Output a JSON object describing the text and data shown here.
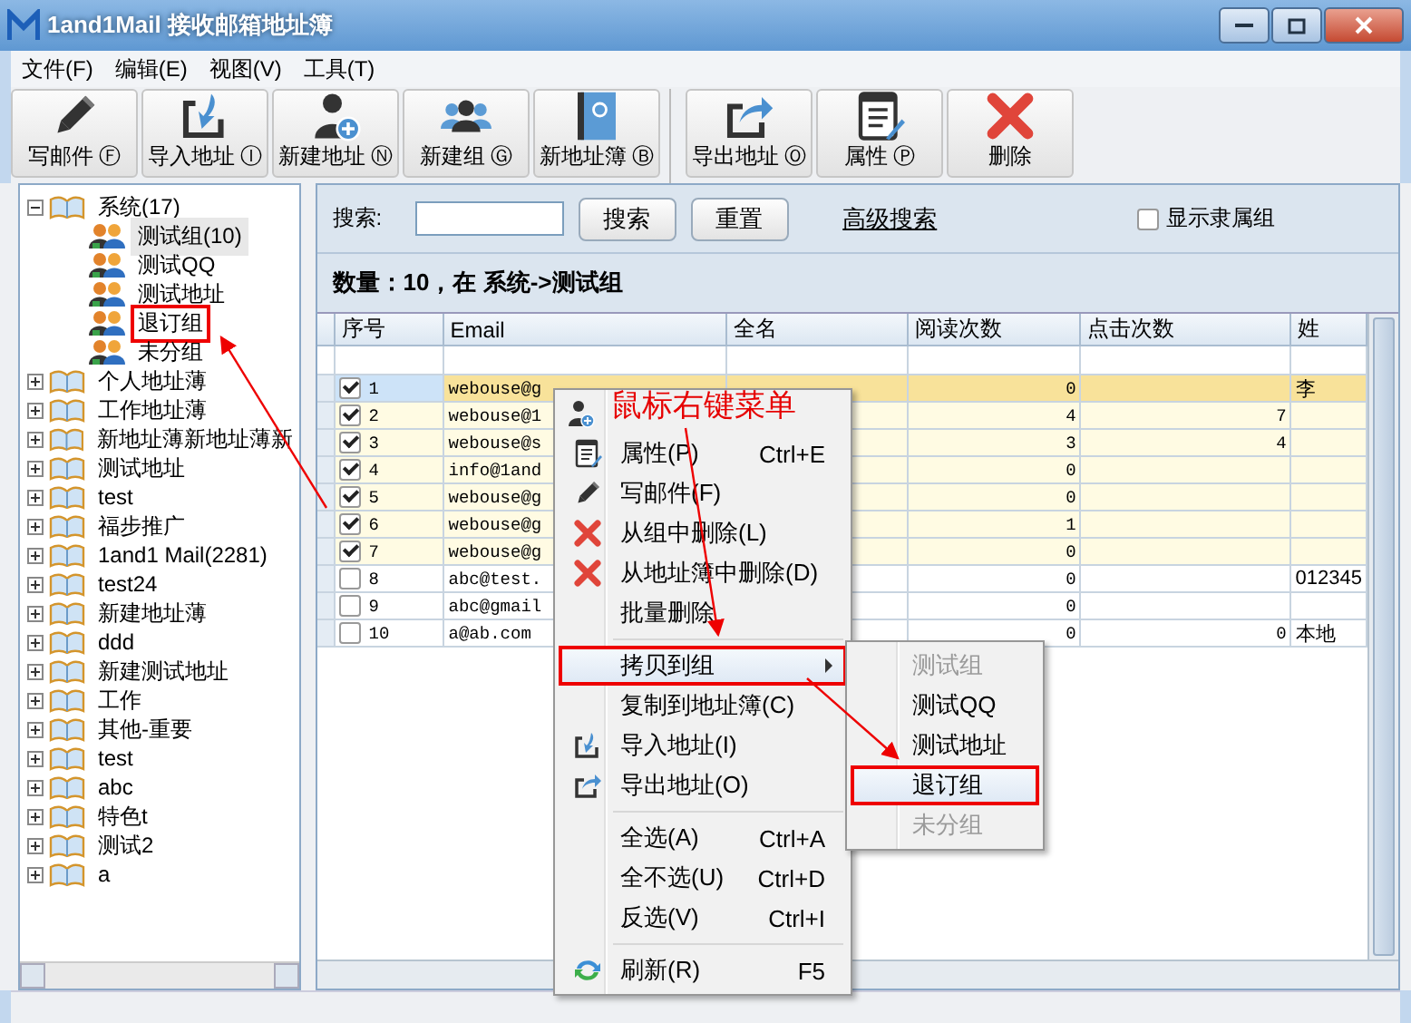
{
  "window": {
    "title": "1and1Mail 接收邮箱地址簿"
  },
  "menu_bar": [
    "文件(F)",
    "编辑(E)",
    "视图(V)",
    "工具(T)"
  ],
  "toolbar": [
    {
      "kind": "pencil",
      "label": "写邮件 Ⓕ"
    },
    {
      "kind": "import",
      "label": "导入地址 Ⓘ"
    },
    {
      "kind": "person",
      "label": "新建地址 Ⓝ"
    },
    {
      "kind": "group",
      "label": "新建组 Ⓖ"
    },
    {
      "kind": "book",
      "label": "新地址簿 Ⓑ"
    },
    {
      "kind": "export",
      "label": "导出地址 Ⓞ"
    },
    {
      "kind": "props",
      "label": "属性 Ⓟ"
    },
    {
      "kind": "delete",
      "label": "删除"
    }
  ],
  "tree": [
    {
      "label": "系统(17)",
      "expanded": true,
      "selected": false,
      "children": [
        {
          "label": "测试组(10)",
          "selected": true,
          "marked": false
        },
        {
          "label": "测试QQ",
          "selected": false,
          "marked": false
        },
        {
          "label": "测试地址",
          "selected": false,
          "marked": false
        },
        {
          "label": "退订组",
          "selected": false,
          "marked": true
        },
        {
          "label": "未分组",
          "selected": false,
          "marked": false
        }
      ]
    },
    {
      "label": "个人地址薄",
      "expanded": false,
      "selected": false
    },
    {
      "label": "工作地址薄",
      "expanded": false,
      "selected": false
    },
    {
      "label": "新地址薄新地址薄新",
      "expanded": false,
      "selected": false
    },
    {
      "label": "测试地址",
      "expanded": false,
      "selected": false
    },
    {
      "label": "test",
      "expanded": false,
      "selected": false
    },
    {
      "label": "福步推广",
      "expanded": false,
      "selected": false
    },
    {
      "label": "1and1 Mail(2281)",
      "expanded": false,
      "selected": false
    },
    {
      "label": "test24",
      "expanded": false,
      "selected": false
    },
    {
      "label": "新建地址薄",
      "expanded": false,
      "selected": false
    },
    {
      "label": "ddd",
      "expanded": false,
      "selected": false
    },
    {
      "label": "新建测试地址",
      "expanded": false,
      "selected": false
    },
    {
      "label": "工作",
      "expanded": false,
      "selected": false
    },
    {
      "label": "其他-重要",
      "expanded": false,
      "selected": false
    },
    {
      "label": "test",
      "expanded": false,
      "selected": false
    },
    {
      "label": "abc",
      "expanded": false,
      "selected": false
    },
    {
      "label": "特色t",
      "expanded": false,
      "selected": false
    },
    {
      "label": "测试2",
      "expanded": false,
      "selected": false
    },
    {
      "label": "a",
      "expanded": false,
      "selected": false
    }
  ],
  "search": {
    "label": "搜索:",
    "search_button": "搜索",
    "reset_button": "重置",
    "advanced_link": "高级搜索",
    "show_groups": {
      "label": "显示隶属组",
      "checked": false
    }
  },
  "count_text": "数量：10，在 系统->测试组",
  "table": {
    "columns": [
      "序号",
      "Email",
      "全名",
      "阅读次数",
      "点击次数",
      "姓"
    ],
    "rows": [
      {
        "no": "1",
        "checked": true,
        "selected": true,
        "email": "webouse@g",
        "reads": "0",
        "surname": "李"
      },
      {
        "no": "2",
        "checked": true,
        "selected": false,
        "email": "webouse@1",
        "reads": "4",
        "clicks": "7"
      },
      {
        "no": "3",
        "checked": true,
        "selected": false,
        "email": "webouse@s",
        "reads": "3",
        "clicks": "4"
      },
      {
        "no": "4",
        "checked": true,
        "selected": false,
        "email": "info@1and",
        "reads": "0"
      },
      {
        "no": "5",
        "checked": true,
        "selected": false,
        "email": "webouse@g",
        "reads": "0"
      },
      {
        "no": "6",
        "checked": true,
        "selected": false,
        "email": "webouse@g",
        "reads": "1"
      },
      {
        "no": "7",
        "checked": true,
        "selected": false,
        "email": "webouse@g",
        "reads": "0"
      },
      {
        "no": "8",
        "checked": false,
        "selected": false,
        "email": "abc@test.",
        "reads": "0",
        "surname": "012345"
      },
      {
        "no": "9",
        "checked": false,
        "selected": false,
        "email": "abc@gmail",
        "reads": "0"
      },
      {
        "no": "10",
        "checked": false,
        "selected": false,
        "email": "a@ab.com",
        "reads": "0",
        "clicks": "0",
        "surname": "本地"
      }
    ]
  },
  "context_menu": {
    "items": [
      {
        "kind": "item",
        "highlighted": false,
        "marked": false
      },
      {
        "kind": "item",
        "label": "属性(P)",
        "shortcut": "Ctrl+E",
        "highlighted": false,
        "marked": false
      },
      {
        "kind": "item",
        "label": "写邮件(F)",
        "highlighted": false,
        "marked": false
      },
      {
        "kind": "item",
        "label": "从组中删除(L)",
        "highlighted": false,
        "marked": false
      },
      {
        "kind": "item",
        "label": "从地址簿中删除(D)",
        "highlighted": false,
        "marked": false
      },
      {
        "kind": "item",
        "label": "批量删除",
        "highlighted": false,
        "marked": false
      },
      {
        "kind": "separator"
      },
      {
        "kind": "submenu",
        "label": "拷贝到组",
        "highlighted": true,
        "marked": true
      },
      {
        "kind": "item",
        "label": "复制到地址簿(C)",
        "highlighted": false,
        "marked": false
      },
      {
        "kind": "item",
        "label": "导入地址(I)",
        "highlighted": false,
        "marked": false
      },
      {
        "kind": "item",
        "label": "导出地址(O)",
        "highlighted": false,
        "marked": false
      },
      {
        "kind": "separator"
      },
      {
        "kind": "item",
        "label": "全选(A)",
        "shortcut": "Ctrl+A",
        "highlighted": false,
        "marked": false
      },
      {
        "kind": "item",
        "label": "全不选(U)",
        "shortcut": "Ctrl+D",
        "highlighted": false,
        "marked": false
      },
      {
        "kind": "item",
        "label": "反选(V)",
        "shortcut": "Ctrl+I",
        "highlighted": false,
        "marked": false
      },
      {
        "kind": "separator"
      },
      {
        "kind": "item",
        "label": "刷新(R)",
        "shortcut": "F5",
        "highlighted": false,
        "marked": false
      }
    ],
    "submenu": [
      {
        "label": "测试组",
        "disabled": true,
        "highlighted": false,
        "marked": false
      },
      {
        "label": "测试QQ",
        "disabled": false,
        "highlighted": false,
        "marked": false
      },
      {
        "label": "测试地址",
        "disabled": false,
        "highlighted": false,
        "marked": false
      },
      {
        "label": "退订组",
        "disabled": false,
        "highlighted": true,
        "marked": true
      },
      {
        "label": "未分组",
        "disabled": true,
        "highlighted": false,
        "marked": false
      }
    ]
  },
  "annotation": {
    "text": "鼠标右键菜单"
  }
}
